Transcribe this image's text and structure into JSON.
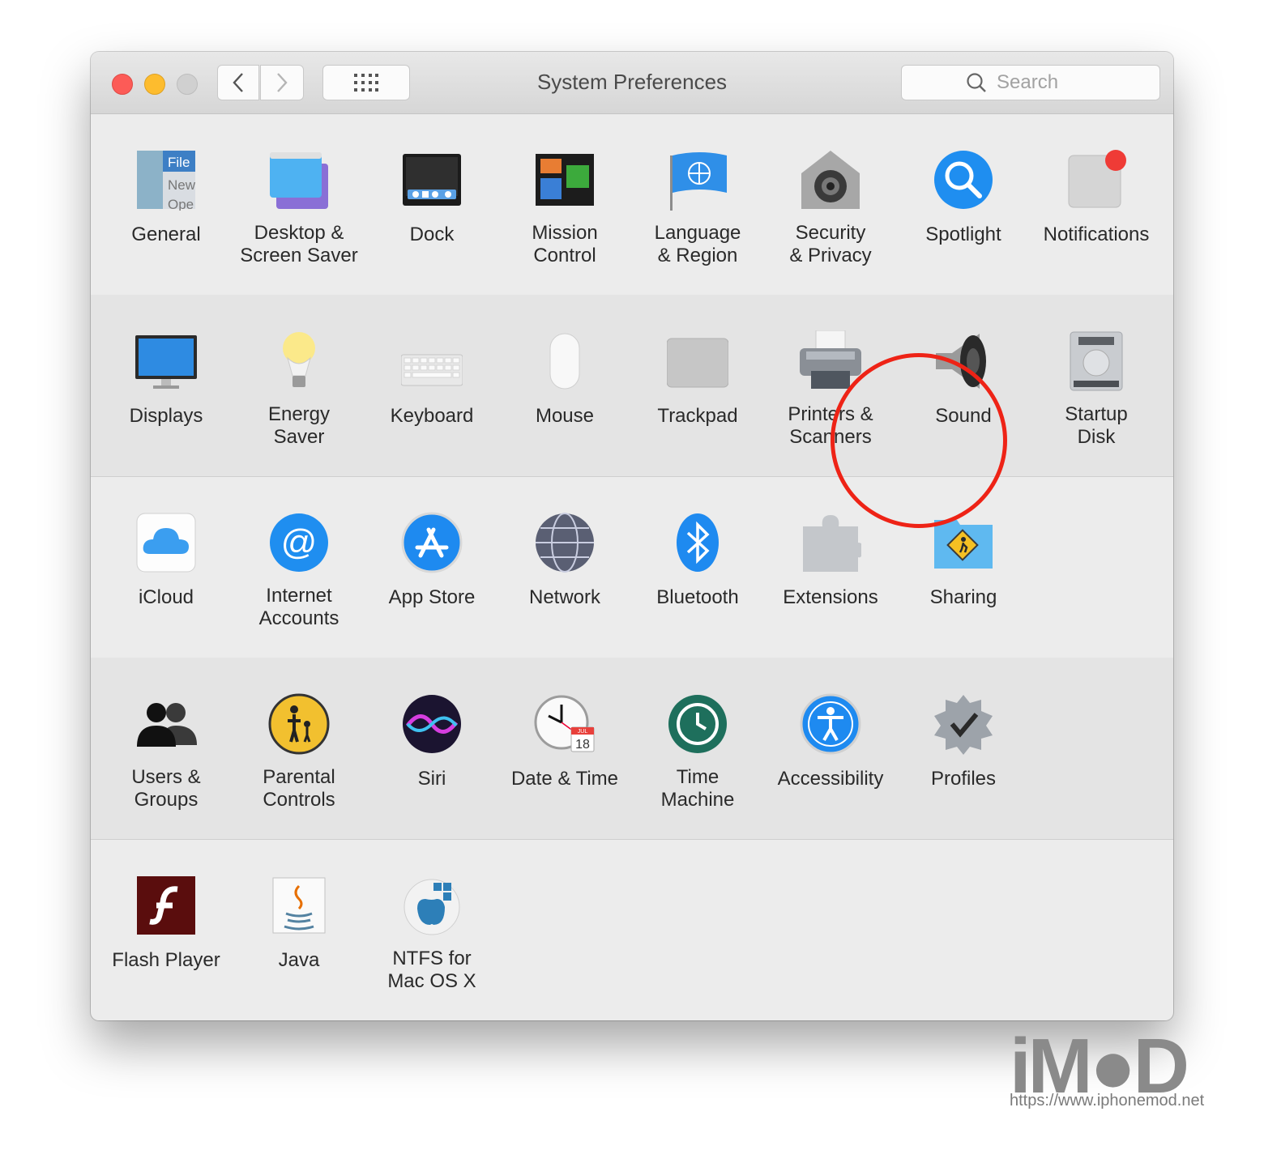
{
  "window": {
    "title": "System Preferences",
    "search_placeholder": "Search"
  },
  "preferences": {
    "row1": [
      {
        "label": "General",
        "icon": "general-icon"
      },
      {
        "label": "Desktop &\nScreen Saver",
        "icon": "desktop-screensaver-icon"
      },
      {
        "label": "Dock",
        "icon": "dock-icon"
      },
      {
        "label": "Mission\nControl",
        "icon": "mission-control-icon"
      },
      {
        "label": "Language\n& Region",
        "icon": "language-region-icon"
      },
      {
        "label": "Security\n& Privacy",
        "icon": "security-privacy-icon"
      },
      {
        "label": "Spotlight",
        "icon": "spotlight-icon"
      },
      {
        "label": "Notifications",
        "icon": "notifications-icon"
      }
    ],
    "row2": [
      {
        "label": "Displays",
        "icon": "displays-icon"
      },
      {
        "label": "Energy\nSaver",
        "icon": "energy-saver-icon"
      },
      {
        "label": "Keyboard",
        "icon": "keyboard-icon"
      },
      {
        "label": "Mouse",
        "icon": "mouse-icon"
      },
      {
        "label": "Trackpad",
        "icon": "trackpad-icon"
      },
      {
        "label": "Printers &\nScanners",
        "icon": "printers-scanners-icon"
      },
      {
        "label": "Sound",
        "icon": "sound-icon"
      },
      {
        "label": "Startup\nDisk",
        "icon": "startup-disk-icon"
      }
    ],
    "row3": [
      {
        "label": "iCloud",
        "icon": "icloud-icon"
      },
      {
        "label": "Internet\nAccounts",
        "icon": "internet-accounts-icon"
      },
      {
        "label": "App Store",
        "icon": "app-store-icon"
      },
      {
        "label": "Network",
        "icon": "network-icon"
      },
      {
        "label": "Bluetooth",
        "icon": "bluetooth-icon"
      },
      {
        "label": "Extensions",
        "icon": "extensions-icon"
      },
      {
        "label": "Sharing",
        "icon": "sharing-icon"
      }
    ],
    "row4": [
      {
        "label": "Users &\nGroups",
        "icon": "users-groups-icon"
      },
      {
        "label": "Parental\nControls",
        "icon": "parental-controls-icon"
      },
      {
        "label": "Siri",
        "icon": "siri-icon"
      },
      {
        "label": "Date & Time",
        "icon": "date-time-icon"
      },
      {
        "label": "Time\nMachine",
        "icon": "time-machine-icon"
      },
      {
        "label": "Accessibility",
        "icon": "accessibility-icon"
      },
      {
        "label": "Profiles",
        "icon": "profiles-icon"
      }
    ],
    "row5": [
      {
        "label": "Flash Player",
        "icon": "flash-player-icon"
      },
      {
        "label": "Java",
        "icon": "java-icon"
      },
      {
        "label": "NTFS for\nMac OS X",
        "icon": "ntfs-icon"
      }
    ]
  },
  "icon_text": {
    "general_file": "File",
    "general_new": "New",
    "general_open": "Ope",
    "calendar_month": "JUL",
    "calendar_day": "18"
  },
  "highlight": {
    "color": "#ee2316",
    "target": "Printers & Scanners"
  },
  "watermark": {
    "logo": "iM●D",
    "url": "https://www.iphonemod.net"
  }
}
